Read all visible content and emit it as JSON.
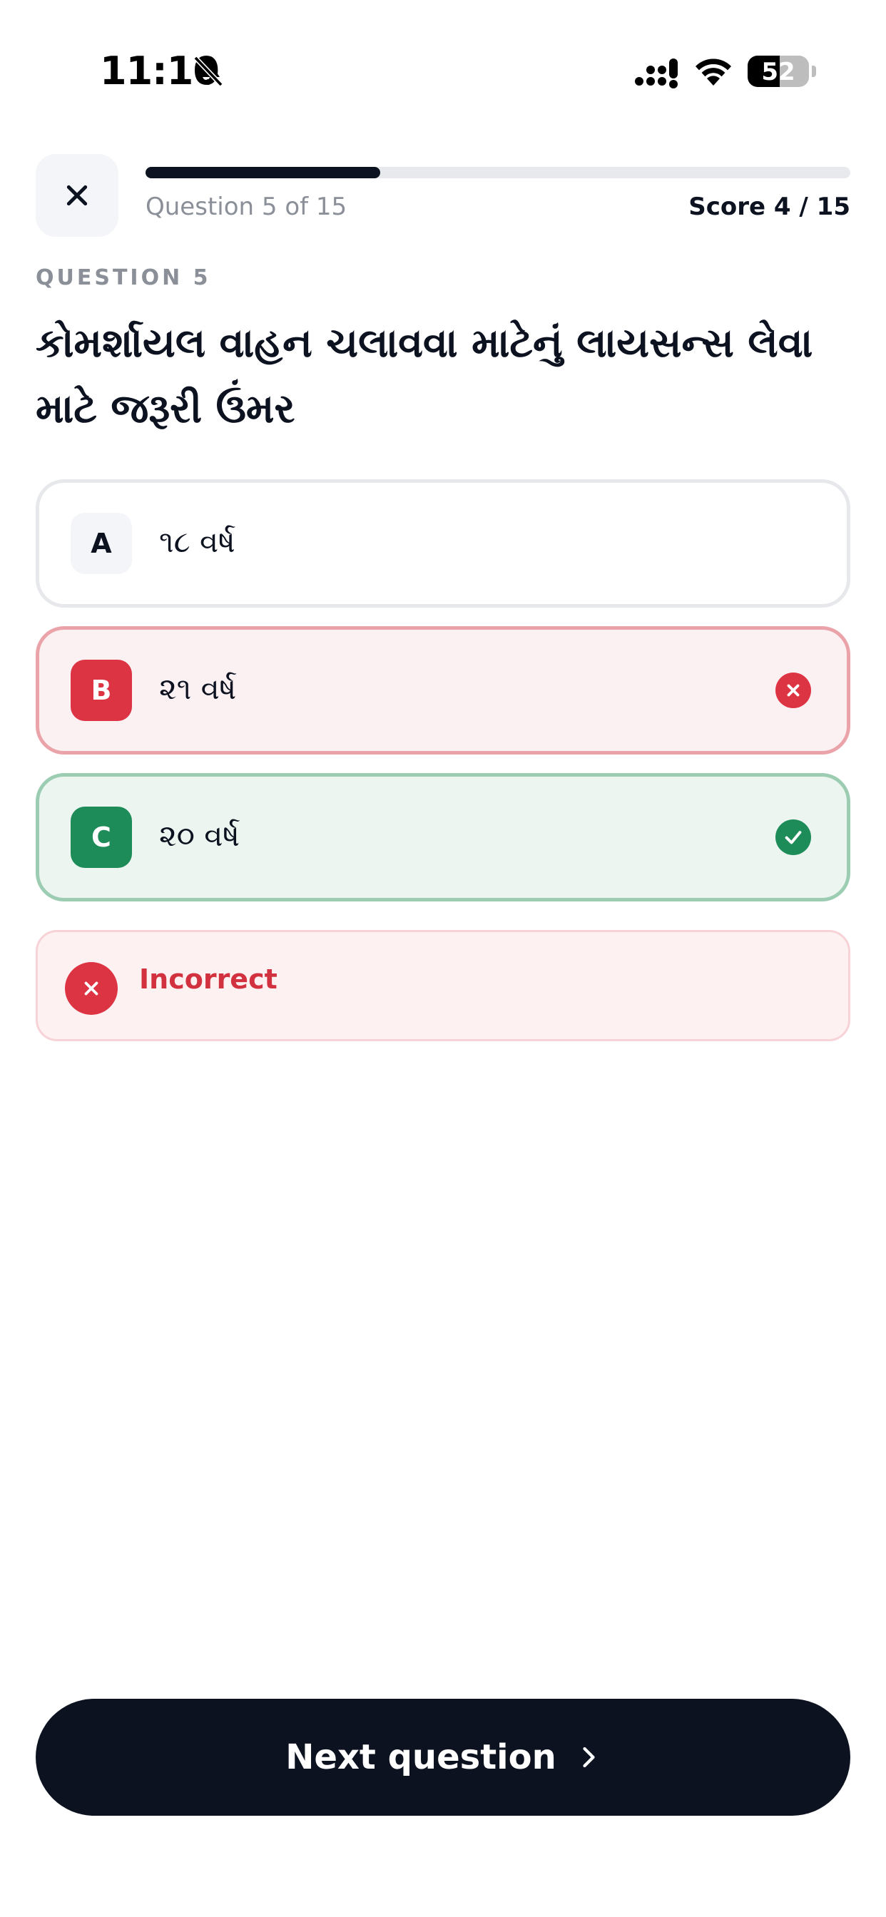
{
  "status_bar": {
    "time": "11:10",
    "battery": "52",
    "icons": [
      "bell-slash-icon",
      "cellular-signal-icon",
      "wifi-icon",
      "battery-icon"
    ]
  },
  "header": {
    "close_icon": "close-icon",
    "progress": 0.3333,
    "question_counter": "Question 5 of 15",
    "score": "Score 4 / 15"
  },
  "question": {
    "label": "QUESTION 5",
    "text": "કોમર્શાયલ વાહન ચલાવવા માટેનું લાયસન્સ લેવા માટે જરૂરી ઉંમર"
  },
  "options": [
    {
      "letter": "A",
      "text": "૧૮ વર્ષ",
      "state": "default"
    },
    {
      "letter": "B",
      "text": "૨૧ વર્ષ",
      "state": "incorrect",
      "status_icon": "x-circle-icon"
    },
    {
      "letter": "C",
      "text": "૨૦ વર્ષ",
      "state": "correct",
      "status_icon": "check-circle-icon"
    }
  ],
  "feedback": {
    "title": "Incorrect",
    "icon": "x-circle-icon"
  },
  "footer": {
    "next_label": "Next question",
    "next_icon": "chevron-right-icon"
  },
  "colors": {
    "primary_dark": "#0d1220",
    "incorrect": "#dd3444",
    "correct": "#1e8c58",
    "muted_text": "#8a8f98"
  }
}
